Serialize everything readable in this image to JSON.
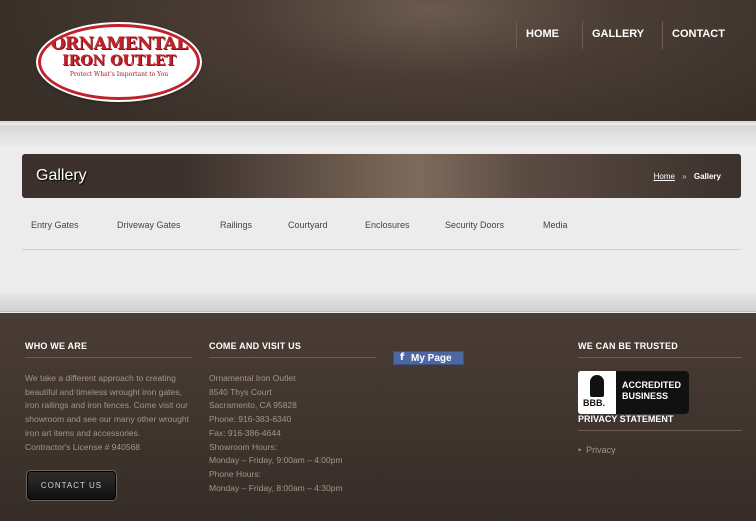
{
  "header": {
    "logo": {
      "line1": "ORNAMENTAL",
      "line2": "IRON OUTLET",
      "tagline": "Protect What's Important to You"
    },
    "nav": [
      "HOME",
      "GALLERY",
      "CONTACT"
    ]
  },
  "titlebar": {
    "title": "Gallery",
    "breadcrumb": {
      "home": "Home",
      "separator": "»",
      "current": "Gallery"
    }
  },
  "categories": [
    "Entry Gates",
    "Driveway Gates",
    "Railings",
    "Courtyard",
    "Enclosures",
    "Security Doors",
    "Media"
  ],
  "footer": {
    "who_we_are": {
      "heading": "WHO WE ARE",
      "text": "We take a different approach to creating beautiful and timeless wrought iron gates, iron railings and iron fences. Come visit our showroom and see our many other wrought iron art items and accessories.",
      "license": "Contractor's License # 940568",
      "button": "CONTACT US"
    },
    "visit": {
      "heading": "COME AND VISIT US",
      "lines": [
        "Ornamental Iron Outlet",
        "8540 Thys Court",
        "Sacramento, CA 95828",
        "Phone: 916-383-6340",
        "Fax: 916-386-4644",
        "Showroom Hours:",
        "Monday – Friday, 9:00am – 4:00pm",
        "Phone Hours:",
        "Monday – Friday, 8:00am – 4:30pm"
      ]
    },
    "facebook": {
      "icon": "f",
      "label": "My Page"
    },
    "trusted": {
      "heading": "WE CAN BE TRUSTED",
      "bbb": {
        "seal": "BBB.",
        "line1": "ACCREDITED",
        "line2": "BUSINESS"
      },
      "privacy_heading": "PRIVACY STATEMENT",
      "privacy_link": "Privacy",
      "bullet": "•"
    }
  },
  "colors": {
    "brand_red": "#c0222b",
    "header_brown": "#3a302a",
    "footer_text": "#a59488"
  }
}
